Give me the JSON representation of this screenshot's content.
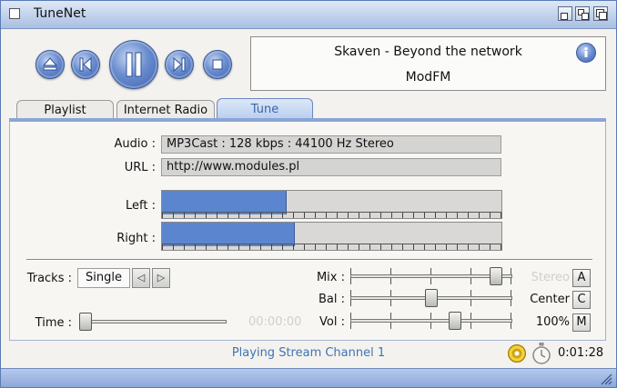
{
  "window": {
    "title": "TuneNet"
  },
  "transport": {
    "buttons": [
      "eject",
      "previous",
      "pause",
      "next",
      "stop"
    ]
  },
  "now_playing": {
    "title": "Skaven - Beyond the network",
    "station": "ModFM"
  },
  "tabs": [
    {
      "label": "Playlist",
      "active": false
    },
    {
      "label": "Internet Radio",
      "active": false
    },
    {
      "label": "Tune",
      "active": true
    }
  ],
  "info": {
    "audio_label": "Audio :",
    "audio_value": "MP3Cast : 128 kbps : 44100 Hz Stereo",
    "url_label": "URL :",
    "url_value": "http://www.modules.pl"
  },
  "meters": {
    "left_label": "Left :",
    "left_level": 0.365,
    "right_label": "Right :",
    "right_level": 0.39
  },
  "controls": {
    "tracks_label": "Tracks :",
    "tracks_mode": "Single",
    "prev_arrow": "◁",
    "next_arrow": "▷",
    "time_label": "Time :",
    "time_value": "00:00:00",
    "time_position": 0.0,
    "mix_label": "Mix :",
    "mix_level": 0.93,
    "bal_label": "Bal :",
    "bal_level": 0.5,
    "vol_label": "Vol :",
    "vol_level": 0.66,
    "mix_readout": "Stereo",
    "mix_button": "A",
    "bal_readout": "Center",
    "bal_button": "C",
    "vol_readout": "100%",
    "vol_button": "M"
  },
  "status": {
    "text": "Playing Stream Channel 1",
    "elapsed": "0:01:28"
  },
  "icons": [
    "close-icon",
    "iconify-icon",
    "zoom-icon",
    "depth-icon",
    "info-icon",
    "disc-icon",
    "stopwatch-icon",
    "resize-grip-icon"
  ],
  "colors": {
    "accent": "#5b86cf",
    "status_text": "#3f73b7",
    "titlebar": "#a9bfe2"
  }
}
